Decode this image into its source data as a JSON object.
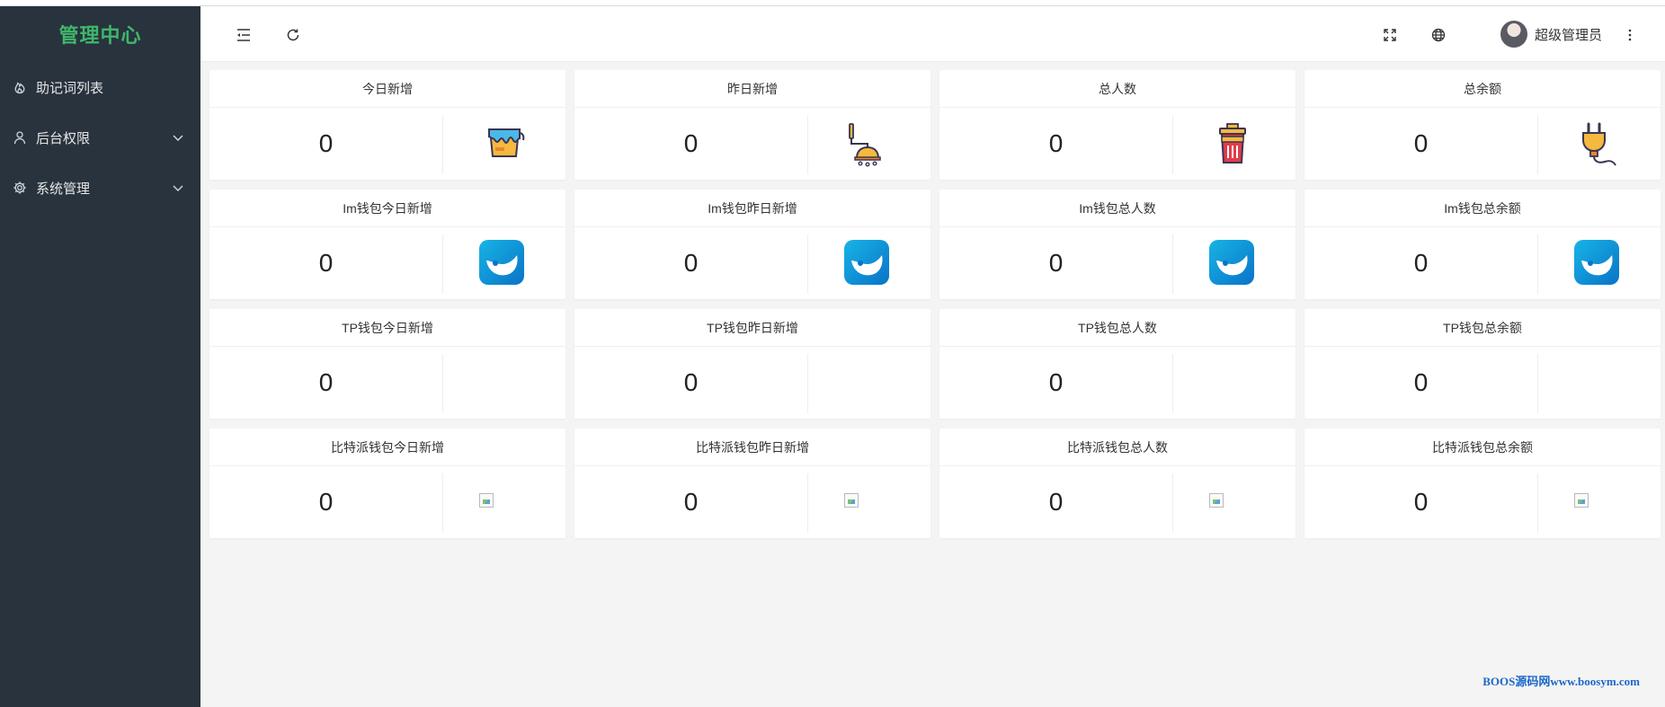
{
  "sidebar": {
    "logo": "管理中心",
    "items": [
      {
        "label": "助记词列表",
        "icon": "fire-icon"
      },
      {
        "label": "后台权限",
        "icon": "user-icon"
      },
      {
        "label": "系统管理",
        "icon": "gear-icon"
      }
    ]
  },
  "header": {
    "user_name": "超级管理员"
  },
  "cards": [
    {
      "title": "今日新增",
      "value": "0",
      "icon": "paint-bucket-icon"
    },
    {
      "title": "昨日新增",
      "value": "0",
      "icon": "shower-icon"
    },
    {
      "title": "总人数",
      "value": "0",
      "icon": "trash-can-icon"
    },
    {
      "title": "总余额",
      "value": "0",
      "icon": "plug-icon"
    },
    {
      "title": "Im钱包今日新增",
      "value": "0",
      "icon": "imtoken-logo-icon"
    },
    {
      "title": "Im钱包昨日新增",
      "value": "0",
      "icon": "imtoken-logo-icon"
    },
    {
      "title": "Im钱包总人数",
      "value": "0",
      "icon": "imtoken-logo-icon"
    },
    {
      "title": "Im钱包总余额",
      "value": "0",
      "icon": "imtoken-logo-icon"
    },
    {
      "title": "TP钱包今日新增",
      "value": "0",
      "icon": ""
    },
    {
      "title": "TP钱包昨日新增",
      "value": "0",
      "icon": ""
    },
    {
      "title": "TP钱包总人数",
      "value": "0",
      "icon": ""
    },
    {
      "title": "TP钱包总余额",
      "value": "0",
      "icon": ""
    },
    {
      "title": "比特派钱包今日新增",
      "value": "0",
      "icon": "broken-image-icon"
    },
    {
      "title": "比特派钱包昨日新增",
      "value": "0",
      "icon": "broken-image-icon"
    },
    {
      "title": "比特派钱包总人数",
      "value": "0",
      "icon": "broken-image-icon"
    },
    {
      "title": "比特派钱包总余额",
      "value": "0",
      "icon": "broken-image-icon"
    }
  ],
  "watermark": "BOOS源码网www.boosym.com"
}
